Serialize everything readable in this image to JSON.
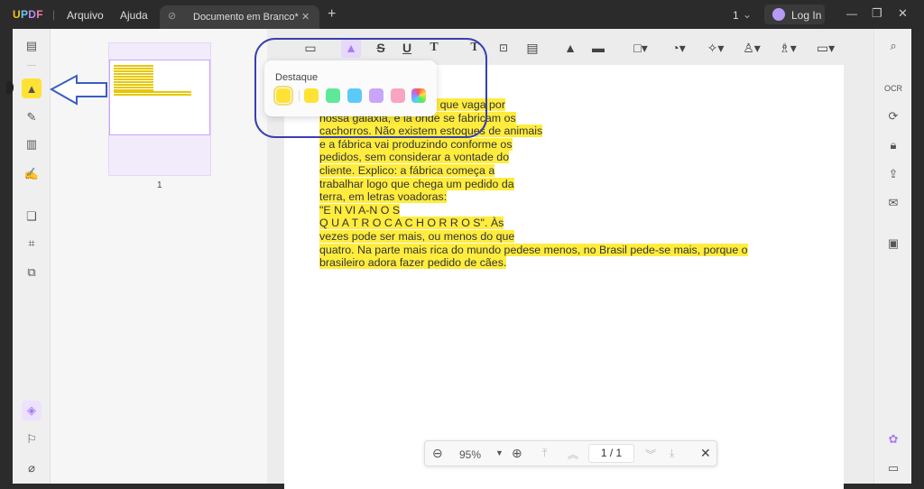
{
  "titlebar": {
    "logo": "UPDF",
    "menu": [
      "Arquivo",
      "Ajuda"
    ],
    "tab_title": "Documento em Branco*",
    "tab_close": "✕",
    "new_tab": "+",
    "page_count": "1",
    "login": "Log In"
  },
  "popup": {
    "title": "Destaque",
    "colors": [
      "#ffe234",
      "#ffe234",
      "#5ee89a",
      "#5ccaf7",
      "#c9a5fa",
      "#f8a5c2"
    ]
  },
  "thumbnail": {
    "page_number": "1"
  },
  "document": {
    "lines": [
      "leste que vaga por",
      "nossa galaxia, e lá onde se fabricam os",
      "cachorros. Não existem estoques de animais",
      "e a fábrica vai produzindo conforme os",
      "pedidos, sem considerar a vontade do",
      "cliente. Explico: a fábrica começa a",
      "trabalhar logo que chega um pedido da",
      "terra, em letras voadoras:",
      "\"E N VI A-N O S",
      "Q U A T R O C A C H O R R O S\". Às",
      "vezes pode ser mais, ou menos do que",
      "quatro. Na parte mais rica do mundo pedese menos, no Brasil pede-se mais, porque o",
      "brasileiro adora fazer pedido de cães."
    ]
  },
  "bottombar": {
    "zoom": "95%",
    "page": "1 / 1"
  },
  "colors": {
    "accent": "#a97cf5",
    "highlight": "#ffec3d",
    "annotation": "#3a3fb0"
  }
}
